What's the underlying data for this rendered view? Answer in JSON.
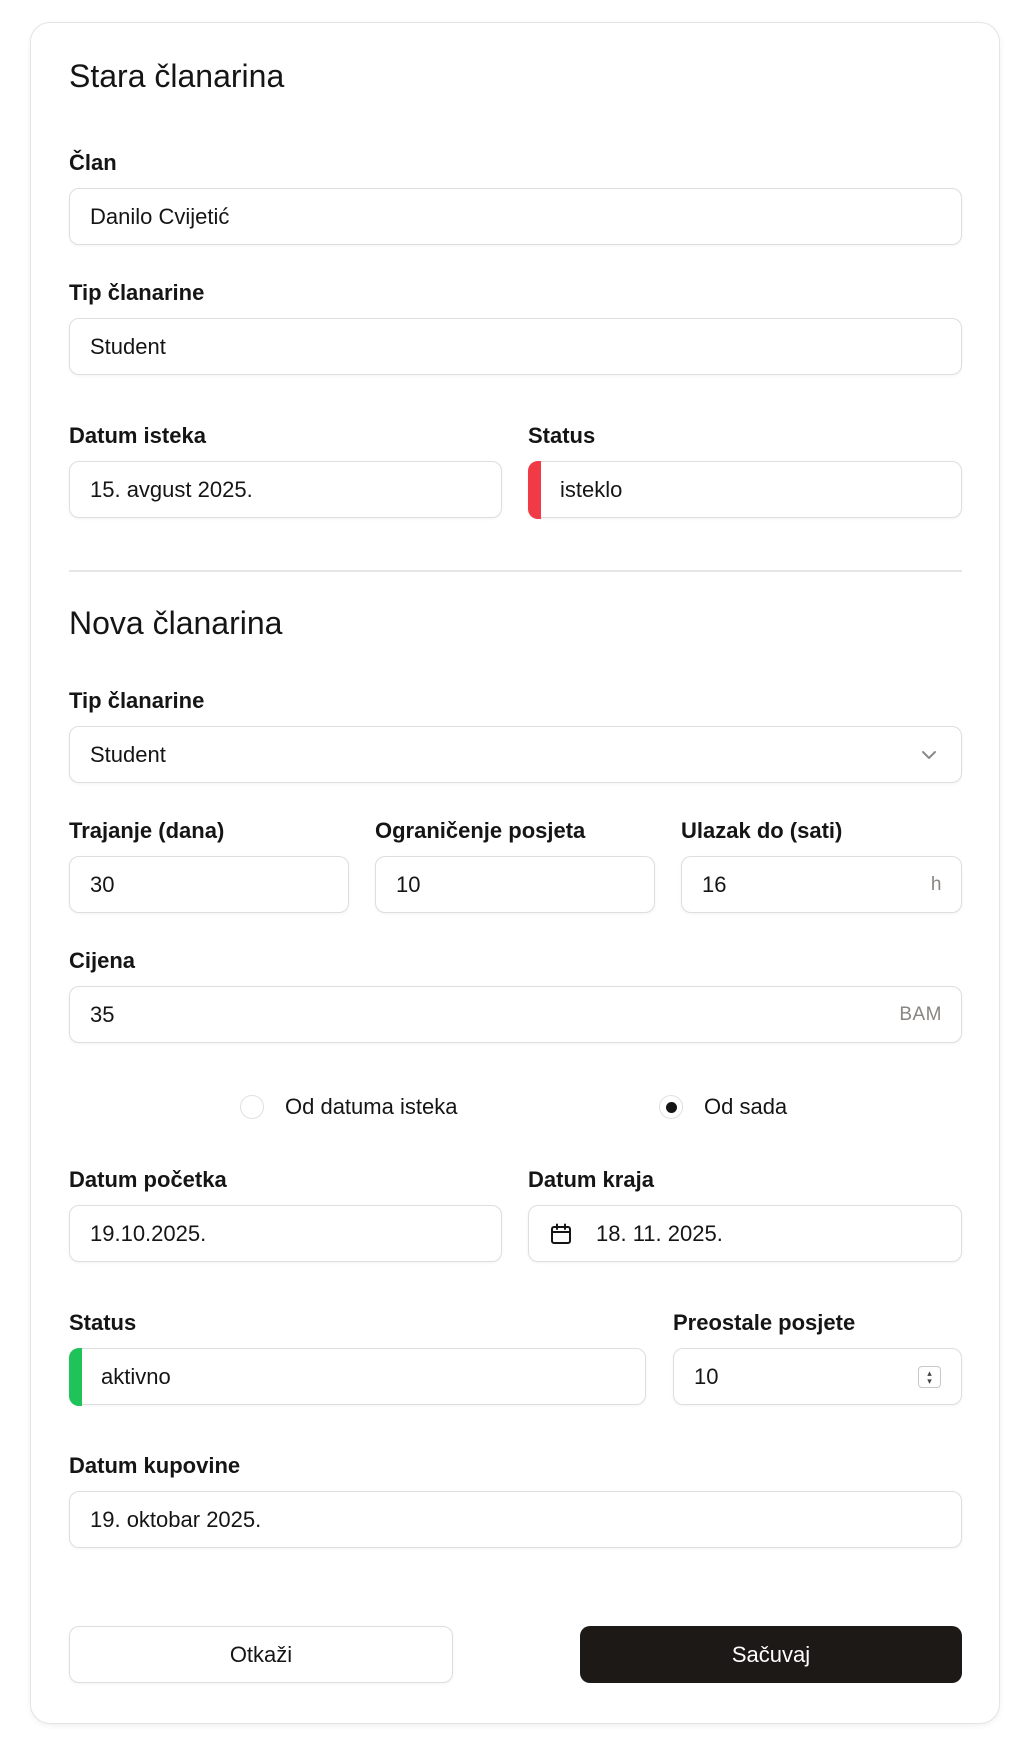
{
  "old": {
    "heading": "Stara članarina",
    "member_label": "Član",
    "member_value": "Danilo Cvijetić",
    "type_label": "Tip članarine",
    "type_value": "Student",
    "expiry_label": "Datum isteka",
    "expiry_value": "15. avgust 2025.",
    "status_label": "Status",
    "status_value": "isteklo",
    "status_color": "#f03a45"
  },
  "new": {
    "heading": "Nova članarina",
    "type_label": "Tip članarine",
    "type_value": "Student",
    "duration_label": "Trajanje (dana)",
    "duration_value": "30",
    "visits_limit_label": "Ograničenje posjeta",
    "visits_limit_value": "10",
    "entry_until_label": "Ulazak do (sati)",
    "entry_until_value": "16",
    "entry_until_suffix": "h",
    "price_label": "Cijena",
    "price_value": "35",
    "price_suffix": "BAM",
    "radio_from_expiry": "Od datuma isteka",
    "radio_from_now": "Od sada",
    "radio_selected": "from_now",
    "start_label": "Datum početka",
    "start_value": "19.10.2025.",
    "end_label": "Datum kraja",
    "end_value": "18. 11. 2025.",
    "status_label": "Status",
    "status_value": "aktivno",
    "status_color": "#1fc35a",
    "remaining_label": "Preostale posjete",
    "remaining_value": "10",
    "purchase_label": "Datum kupovine",
    "purchase_value": "19. oktobar 2025."
  },
  "actions": {
    "cancel_label": "Otkaži",
    "save_label": "Sačuvaj"
  },
  "icons": {
    "dropdown": "chevron-down-icon",
    "calendar": "calendar-icon",
    "stepper": "stepper-icon"
  }
}
